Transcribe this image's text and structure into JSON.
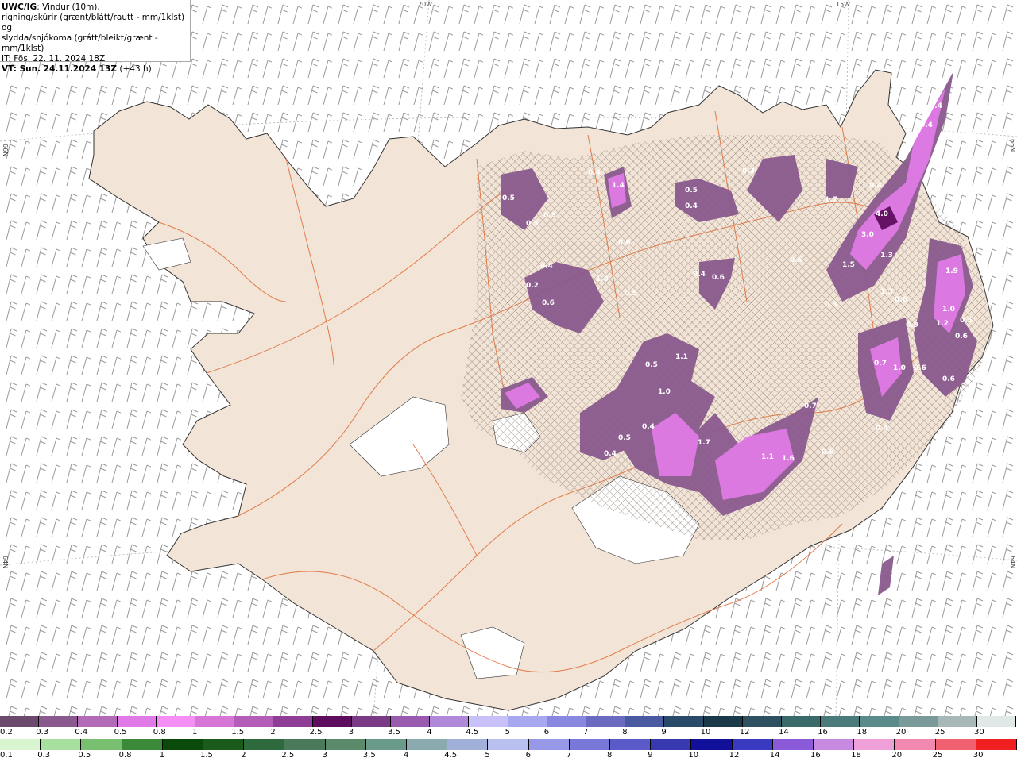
{
  "title": {
    "product": "UWC/IG",
    "line1_rest": ": Vindur (10m),",
    "line2": "rigning/skúrir (grænt/blátt/rautt - mm/1klst) og",
    "line3": "slydda/snjókoma (grátt/bleikt/grænt - mm/1klst)",
    "line4": "IT: Fös. 22. 11. 2024 18Z",
    "line5_bold": "VT: Sun. 24.11.2024 13Z",
    "line5_rest": " (+43 h)"
  },
  "coords": {
    "lon_20w": "20W",
    "lon_15w": "15W",
    "lat_66n_left": "66N",
    "lat_66n_right": "66N",
    "lat_64n_left": "64N",
    "lat_64n_right": "64N"
  },
  "map_values": [
    {
      "text": "1.4"
    },
    {
      "text": "0.4"
    },
    {
      "text": "0.5"
    },
    {
      "text": "0.5"
    },
    {
      "text": "0.3"
    },
    {
      "text": "0.5"
    },
    {
      "text": "0.4"
    },
    {
      "text": "0.6"
    },
    {
      "text": "0.4"
    },
    {
      "text": "1.0"
    },
    {
      "text": "0.2"
    },
    {
      "text": "0.6"
    },
    {
      "text": "0.5"
    },
    {
      "text": "0.4"
    },
    {
      "text": "0.6"
    },
    {
      "text": "1.7"
    },
    {
      "text": "0.3"
    },
    {
      "text": "0.4"
    },
    {
      "text": "4.0"
    },
    {
      "text": "3.0"
    },
    {
      "text": "1.5"
    },
    {
      "text": "1.3"
    },
    {
      "text": "1.3"
    },
    {
      "text": "0.6"
    },
    {
      "text": "1.9"
    },
    {
      "text": "1.0"
    },
    {
      "text": "1.2"
    },
    {
      "text": "0.5"
    },
    {
      "text": "0.9"
    },
    {
      "text": "0.6"
    },
    {
      "text": "0.5"
    },
    {
      "text": "1.1"
    },
    {
      "text": "1.0"
    },
    {
      "text": "0.5"
    },
    {
      "text": "0.4"
    },
    {
      "text": "1.7"
    },
    {
      "text": "1.1"
    },
    {
      "text": "1.6"
    },
    {
      "text": "0.6"
    },
    {
      "text": "0.7"
    },
    {
      "text": "0.4"
    },
    {
      "text": "1.0"
    },
    {
      "text": "0.6"
    },
    {
      "text": "0.6"
    },
    {
      "text": "0.4"
    },
    {
      "text": "0.4"
    },
    {
      "text": "0.3"
    },
    {
      "text": "0.4"
    },
    {
      "text": "0.6"
    },
    {
      "text": "0.7"
    }
  ],
  "legend_snow": {
    "labels": [
      "0.2",
      "0.3",
      "0.4",
      "0.5",
      "0.8",
      "1",
      "1.5",
      "2",
      "2.5",
      "3",
      "3.5",
      "4",
      "4.5",
      "5",
      "6",
      "7",
      "8",
      "9",
      "10",
      "12",
      "14",
      "16",
      "18",
      "20",
      "25",
      "30"
    ],
    "colors": [
      "#6b4a6e",
      "#8a5a8e",
      "#b36bb8",
      "#e07ae6",
      "#f58ff5",
      "#d876d8",
      "#b35cb8",
      "#8e3e96",
      "#5e0d5e",
      "#7a3a86",
      "#9a5ab0",
      "#b08ad8",
      "#c8c0f8",
      "#a8a8f0",
      "#8888e0",
      "#6a6ac0",
      "#4a5aa0",
      "#2a4a6a",
      "#1a3a4a",
      "#2e5060",
      "#3a6a6a",
      "#4a7a7a",
      "#5a8a8a",
      "#7a9a9a",
      "#a8b8b8",
      "#e0e8e8"
    ]
  },
  "legend_rain": {
    "labels": [
      "0.1",
      "0.3",
      "0.5",
      "0.8",
      "1",
      "1.5",
      "2",
      "2.5",
      "3",
      "3.5",
      "4",
      "4.5",
      "5",
      "6",
      "7",
      "8",
      "9",
      "10",
      "12",
      "14",
      "16",
      "18",
      "20",
      "25",
      "30"
    ],
    "colors": [
      "#d8f5d0",
      "#a8e0a0",
      "#78c070",
      "#3a8a3a",
      "#0a4a0a",
      "#1a5a1a",
      "#2e6a3e",
      "#4a7a5a",
      "#5a8a6a",
      "#6a9a8a",
      "#8aaab0",
      "#a0b0d8",
      "#b8c0f0",
      "#9898e8",
      "#7878d8",
      "#5a5ac8",
      "#3838b0",
      "#10109a",
      "#3a3ac0",
      "#8a5ad8",
      "#c88ae0",
      "#f0a0d8",
      "#f088b0",
      "#f06070",
      "#f02020"
    ]
  }
}
